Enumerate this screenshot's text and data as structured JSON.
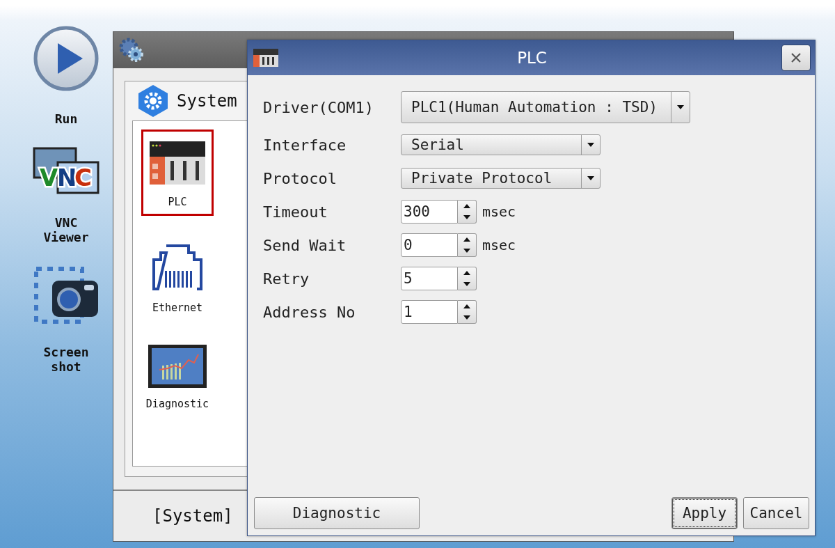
{
  "desktop_shortcuts": [
    {
      "kind": "run",
      "label": "Run"
    },
    {
      "kind": "vnc",
      "label": "VNC Viewer",
      "logo_text": "VNC"
    },
    {
      "kind": "screenshot",
      "label": "Screen shot"
    }
  ],
  "system_window": {
    "header": "System",
    "items": [
      {
        "kind": "plc",
        "label": "PLC",
        "selected": true
      },
      {
        "kind": "ethernet",
        "label": "Ethernet",
        "selected": false
      },
      {
        "kind": "diagnostic",
        "label": "Diagnostic",
        "selected": false
      }
    ],
    "footer": "[System]"
  },
  "plc_dialog": {
    "title": "PLC",
    "fields": [
      {
        "kind": "wide_dropdown",
        "label": "Driver(COM1)",
        "value": "PLC1(Human Automation : TSD)"
      },
      {
        "kind": "dropdown",
        "label": "Interface",
        "value": "Serial"
      },
      {
        "kind": "dropdown",
        "label": "Protocol",
        "value": "Private Protocol"
      },
      {
        "kind": "spinner",
        "label": "Timeout",
        "value": "300",
        "unit": "msec"
      },
      {
        "kind": "spinner",
        "label": "Send Wait",
        "value": "0",
        "unit": "msec"
      },
      {
        "kind": "spinner",
        "label": "Retry",
        "value": "5"
      },
      {
        "kind": "spinner",
        "label": "Address No",
        "value": "1"
      }
    ],
    "buttons": [
      {
        "label": "Diagnostic",
        "focused": false
      },
      {
        "label": "Apply",
        "focused": true
      },
      {
        "label": "Cancel",
        "focused": false
      }
    ]
  }
}
